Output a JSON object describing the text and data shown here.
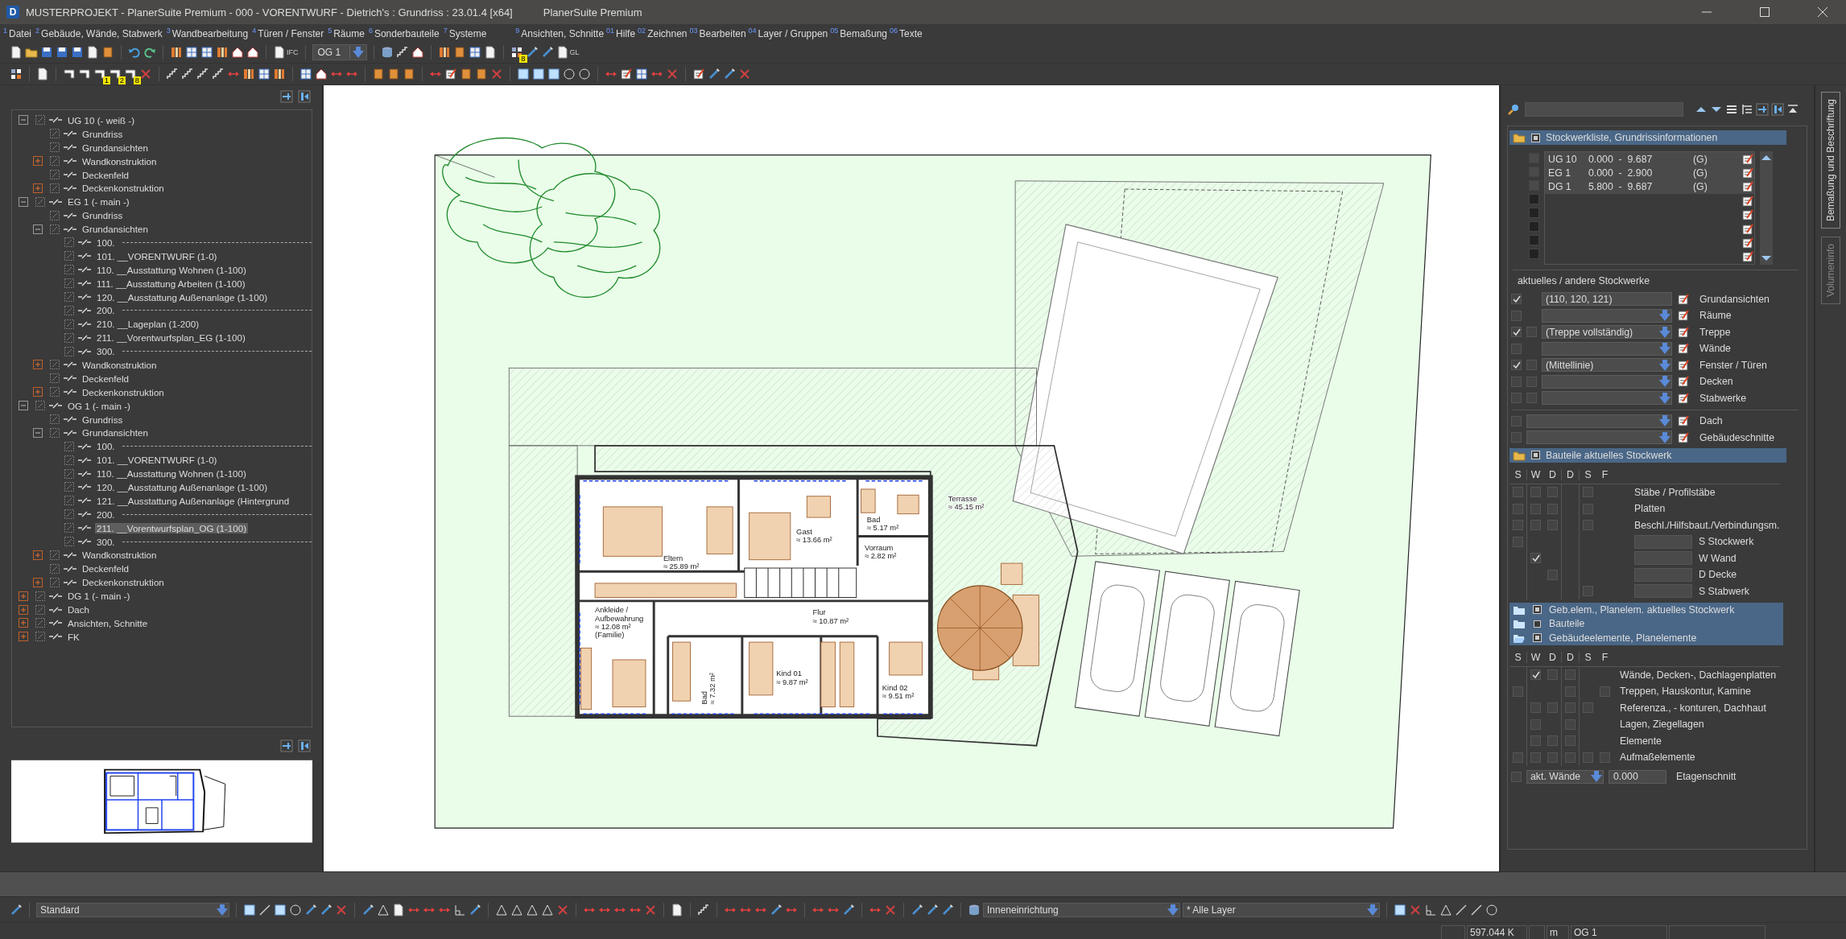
{
  "title_bar": {
    "app_letter": "D",
    "title": "MUSTERPROJEKT - PlanerSuite Premium - 000 - VORENTWURF - Dietrich's : Grundriss : 23.01.4 [x64]",
    "product": "PlanerSuite Premium"
  },
  "menu": {
    "left": [
      {
        "key": "1",
        "label": "Datei"
      },
      {
        "key": "2",
        "label": "Gebäude, Wände, Stabwerk"
      },
      {
        "key": "3",
        "label": "Wandbearbeitung"
      },
      {
        "key": "4",
        "label": "Türen / Fenster"
      },
      {
        "key": "5",
        "label": "Räume"
      },
      {
        "key": "6",
        "label": "Sonderbauteile"
      },
      {
        "key": "7",
        "label": "Systeme"
      }
    ],
    "right": [
      {
        "key": "9",
        "label": "Ansichten, Schnitte"
      },
      {
        "key": "01",
        "label": "Hilfe"
      },
      {
        "key": "02",
        "label": "Zeichnen"
      },
      {
        "key": "03",
        "label": "Bearbeiten"
      },
      {
        "key": "04",
        "label": "Layer / Gruppen"
      },
      {
        "key": "05",
        "label": "Bemaßung"
      },
      {
        "key": "06",
        "label": "Texte"
      }
    ]
  },
  "toolbar_1": {
    "floor_select": "OG 1",
    "icon_captions": [
      "IFC",
      "GL"
    ],
    "badges": [
      "8"
    ]
  },
  "toolbar_2": {
    "badges": [
      "1",
      "2",
      "8"
    ]
  },
  "left_panel": {
    "tree": [
      {
        "label": "UG 10 (- weiß -)",
        "expanded": true,
        "selected": false,
        "children": [
          {
            "label": "Grundriss",
            "selected": false
          },
          {
            "label": "Grundansichten",
            "selected": false
          },
          {
            "label": "Wandkonstruktion",
            "expanded": false,
            "selected": false
          },
          {
            "label": "Deckenfeld",
            "selected": false
          },
          {
            "label": "Deckenkonstruktion",
            "expanded": false,
            "selected": false
          }
        ]
      },
      {
        "label": "EG 1 (- main -)",
        "expanded": true,
        "selected": false,
        "children": [
          {
            "label": "Grundriss",
            "selected": false
          },
          {
            "label": "Grundansichten",
            "expanded": true,
            "selected": false,
            "children": [
              {
                "kind": "separator",
                "label": "100.",
                "selected": false
              },
              {
                "kind": "view",
                "label": "101. __VORENTWURF (1-0)",
                "selected": false
              },
              {
                "kind": "view",
                "label": "110. __Ausstattung Wohnen (1-100)",
                "selected": false
              },
              {
                "kind": "view",
                "label": "111. __Ausstattung Arbeiten (1-100)",
                "selected": false
              },
              {
                "kind": "view",
                "label": "120. __Ausstattung Außenanlage (1-100)",
                "selected": false
              },
              {
                "kind": "separator",
                "label": "200.",
                "selected": false
              },
              {
                "kind": "view",
                "label": "210. __Lageplan (1-200)",
                "selected": false
              },
              {
                "kind": "view",
                "label": "211. __Vorentwurfsplan_EG (1-100)",
                "selected": false
              },
              {
                "kind": "separator",
                "label": "300.",
                "selected": false
              }
            ]
          },
          {
            "label": "Wandkonstruktion",
            "expanded": false,
            "selected": false
          },
          {
            "label": "Deckenfeld",
            "selected": false
          },
          {
            "label": "Deckenkonstruktion",
            "expanded": false,
            "selected": false
          }
        ]
      },
      {
        "label": "OG 1 (- main -)",
        "expanded": true,
        "selected": false,
        "children": [
          {
            "label": "Grundriss",
            "selected": false
          },
          {
            "label": "Grundansichten",
            "expanded": true,
            "selected": false,
            "children": [
              {
                "kind": "separator",
                "label": "100.",
                "selected": false
              },
              {
                "kind": "view",
                "label": "101. __VORENTWURF (1-0)",
                "selected": false
              },
              {
                "kind": "view",
                "label": "110. __Ausstattung Wohnen (1-100)",
                "selected": false
              },
              {
                "kind": "view",
                "label": "120. __Ausstattung Außenanlage (1-100)",
                "selected": false
              },
              {
                "kind": "view",
                "label": "121. __Ausstattung Außenanlage (Hintergrund",
                "selected": false
              },
              {
                "kind": "separator",
                "label": "200.",
                "selected": false
              },
              {
                "kind": "view",
                "label": "211. __Vorentwurfsplan_OG (1-100)",
                "selected": true
              },
              {
                "kind": "separator",
                "label": "300.",
                "selected": false
              }
            ]
          },
          {
            "label": "Wandkonstruktion",
            "expanded": false,
            "selected": false
          },
          {
            "label": "Deckenfeld",
            "selected": false
          },
          {
            "label": "Deckenkonstruktion",
            "expanded": false,
            "selected": false
          }
        ]
      },
      {
        "label": "DG 1 (- main -)",
        "expanded": false,
        "selected": false
      },
      {
        "label": "Dach",
        "expanded": false,
        "selected": false
      },
      {
        "label": "Ansichten, Schnitte",
        "expanded": false,
        "selected": false
      },
      {
        "label": "FK",
        "expanded": false,
        "selected": false
      }
    ]
  },
  "canvas": {
    "room_labels": [
      {
        "lines": [
          "Eltern",
          "≈ 25.89 m²"
        ]
      },
      {
        "lines": [
          "Gast",
          "≈ 13.66 m²"
        ]
      },
      {
        "lines": [
          "Bad",
          "≈ 5.17 m²"
        ]
      },
      {
        "lines": [
          "Vorraum",
          "≈ 2.82 m²"
        ]
      },
      {
        "lines": [
          "Ankleide /",
          "Aufbewahrung",
          "≈ 12.08 m²",
          "(Familie)"
        ]
      },
      {
        "lines": [
          "Flur",
          "≈ 10.87 m²"
        ]
      },
      {
        "lines": [
          "Kind 01",
          "≈ 9.87 m²"
        ]
      },
      {
        "lines": [
          "Kind 02",
          "≈ 9.51 m²"
        ]
      },
      {
        "lines": [
          "Terrasse",
          "≈ 45.15 m²"
        ]
      },
      {
        "lines": [
          "Bad",
          "≈ 7.32 m²"
        ]
      }
    ]
  },
  "right_panel": {
    "floor_section": {
      "title": "Stockwerkliste, Grundrissinformationen",
      "floors": [
        {
          "checked": false,
          "name": "UG 10",
          "range": "0.000  -  9.687",
          "flag": "(G)"
        },
        {
          "checked": false,
          "name": "EG 1",
          "range": "0.000  -  2.900",
          "flag": "(G)"
        },
        {
          "checked": false,
          "name": "DG 1",
          "range": "5.800  -  9.687",
          "flag": "(G)"
        }
      ]
    },
    "other_floors": {
      "heading": "aktuelles / andere Stockwerke",
      "rows": [
        {
          "checked": true,
          "dropdown": false,
          "value": "(110, 120, 121)",
          "label": "Grundansichten"
        },
        {
          "checked": false,
          "dropdown": true,
          "label": "Räume"
        },
        {
          "checked": true,
          "second_checked": false,
          "dropdown": true,
          "value": "(Treppe vollständig)",
          "label": "Treppe"
        },
        {
          "checked": false,
          "dropdown": true,
          "label": "Wände"
        },
        {
          "checked": true,
          "second_checked": false,
          "dropdown": true,
          "value": "(Mittellinie)",
          "label": "Fenster / Türen"
        },
        {
          "checked": false,
          "second_checked": false,
          "dropdown": true,
          "label": "Decken"
        },
        {
          "checked": false,
          "second_checked": false,
          "dropdown": true,
          "label": "Stabwerke"
        }
      ],
      "building_rows": [
        {
          "checked": false,
          "label": "Dach"
        },
        {
          "checked": false,
          "label": "Gebäudeschnitte"
        }
      ]
    },
    "components": {
      "title": "Bauteile aktuelles Stockwerk",
      "columns": [
        "S",
        "W",
        "D",
        "D",
        "S",
        "F"
      ],
      "rows": [
        {
          "kind": "plain",
          "slots": [
            {
              "kind": "box",
              "checked": false
            },
            {
              "kind": "box",
              "checked": false
            },
            {
              "kind": "box",
              "checked": false
            },
            {
              "kind": "blank"
            },
            {
              "kind": "box",
              "checked": false
            },
            {
              "kind": "blank"
            }
          ],
          "label": "Stäbe / Profilstäbe"
        },
        {
          "kind": "plain",
          "slots": [
            {
              "kind": "box",
              "checked": false
            },
            {
              "kind": "box",
              "checked": false
            },
            {
              "kind": "box",
              "checked": false
            },
            {
              "kind": "blank"
            },
            {
              "kind": "box",
              "checked": false
            },
            {
              "kind": "blank"
            }
          ],
          "label": "Platten"
        },
        {
          "kind": "plain",
          "slots": [
            {
              "kind": "box",
              "checked": false
            },
            {
              "kind": "box",
              "checked": false
            },
            {
              "kind": "box",
              "checked": false
            },
            {
              "kind": "blank"
            },
            {
              "kind": "box",
              "checked": false
            },
            {
              "kind": "blank"
            }
          ],
          "label": "Beschl./Hilfsbaut./Verbindungsm."
        },
        {
          "kind": "field",
          "slots": [
            {
              "kind": "box",
              "checked": false
            },
            {
              "kind": "blank"
            },
            {
              "kind": "blank"
            },
            {
              "kind": "blank"
            },
            {
              "kind": "blank"
            },
            {
              "kind": "blank"
            }
          ],
          "label": "S Stockwerk"
        },
        {
          "kind": "field",
          "slots": [
            {
              "kind": "blank"
            },
            {
              "kind": "box",
              "checked": true
            },
            {
              "kind": "blank"
            },
            {
              "kind": "blank"
            },
            {
              "kind": "blank"
            },
            {
              "kind": "blank"
            }
          ],
          "label": "W Wand"
        },
        {
          "kind": "field",
          "slots": [
            {
              "kind": "blank"
            },
            {
              "kind": "blank"
            },
            {
              "kind": "box",
              "checked": false
            },
            {
              "kind": "blank"
            },
            {
              "kind": "blank"
            },
            {
              "kind": "blank"
            }
          ],
          "label": "D Decke"
        },
        {
          "kind": "field",
          "slots": [
            {
              "kind": "blank"
            },
            {
              "kind": "blank"
            },
            {
              "kind": "blank"
            },
            {
              "kind": "blank"
            },
            {
              "kind": "box",
              "checked": false
            },
            {
              "kind": "blank"
            }
          ],
          "label": "S Stabwerk"
        }
      ]
    },
    "element_groups": [
      {
        "open": false,
        "checked": true,
        "label": "Geb.elem., Planelem. aktuelles Stockwerk"
      },
      {
        "open": false,
        "checked": false,
        "label": "Bauteile"
      },
      {
        "open": true,
        "checked": true,
        "label": "Gebäudeelemente, Planelemente"
      }
    ],
    "elements": {
      "columns": [
        "S",
        "W",
        "D",
        "D",
        "S",
        "F"
      ],
      "rows": [
        {
          "slots": [
            {
              "kind": "blank"
            },
            {
              "kind": "box",
              "checked": true
            },
            {
              "kind": "box",
              "checked": false
            },
            {
              "kind": "box",
              "checked": false
            },
            {
              "kind": "blank"
            },
            {
              "kind": "blank"
            }
          ],
          "label": "Wände, Decken-, Dachlagenplatten"
        },
        {
          "slots": [
            {
              "kind": "box",
              "checked": false
            },
            {
              "kind": "blank"
            },
            {
              "kind": "blank"
            },
            {
              "kind": "box",
              "checked": false
            },
            {
              "kind": "blank"
            },
            {
              "kind": "box",
              "checked": false
            }
          ],
          "label": "Treppen, Hauskontur, Kamine"
        },
        {
          "slots": [
            {
              "kind": "blank"
            },
            {
              "kind": "box",
              "checked": false
            },
            {
              "kind": "box",
              "checked": false
            },
            {
              "kind": "box",
              "checked": false
            },
            {
              "kind": "box",
              "checked": false
            },
            {
              "kind": "blank"
            }
          ],
          "label": "Referenza., - konturen, Dachhaut"
        },
        {
          "slots": [
            {
              "kind": "blank"
            },
            {
              "kind": "box",
              "checked": false
            },
            {
              "kind": "blank"
            },
            {
              "kind": "box",
              "checked": false
            },
            {
              "kind": "blank"
            },
            {
              "kind": "blank"
            }
          ],
          "label": "Lagen, Ziegellagen"
        },
        {
          "slots": [
            {
              "kind": "blank"
            },
            {
              "kind": "box",
              "checked": false
            },
            {
              "kind": "box",
              "checked": false
            },
            {
              "kind": "box",
              "checked": false
            },
            {
              "kind": "blank"
            },
            {
              "kind": "blank"
            }
          ],
          "label": "Elemente"
        },
        {
          "slots": [
            {
              "kind": "box",
              "checked": false
            },
            {
              "kind": "box",
              "checked": false
            },
            {
              "kind": "box",
              "checked": false
            },
            {
              "kind": "box",
              "checked": false
            },
            {
              "kind": "box",
              "checked": false
            },
            {
              "kind": "box",
              "checked": false
            }
          ],
          "label": "Aufmaßelemente"
        }
      ]
    },
    "floor_cut": {
      "checked": false,
      "mode": "akt. Wände",
      "value": "0.000",
      "label": "Etagenschnitt"
    }
  },
  "side_tabs": [
    {
      "label": "Bemaßung und Beschriftung",
      "selected": true
    },
    {
      "label": "Volumeninfo",
      "selected": false
    }
  ],
  "bottom_toolbar": {
    "selects": [
      "Standard",
      "Inneneinrichtung",
      "* Alle Layer"
    ]
  },
  "status_bar": {
    "cells": [
      "597.044 K",
      "m",
      "OG 1"
    ]
  }
}
